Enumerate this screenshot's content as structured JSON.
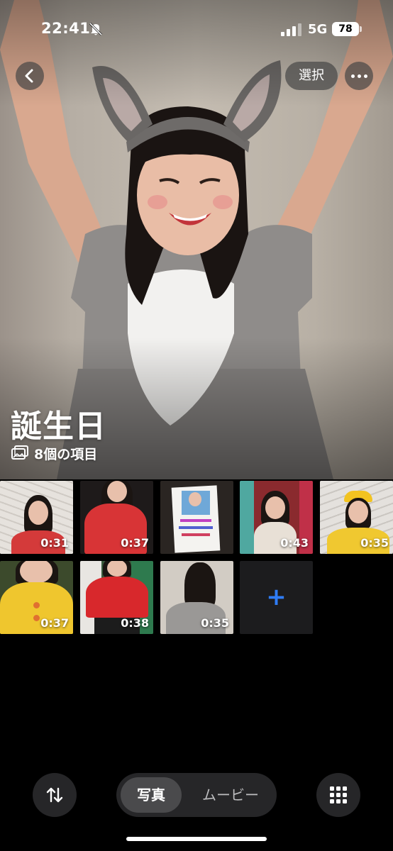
{
  "status_bar": {
    "time": "22:41",
    "network": "5G",
    "battery": "78"
  },
  "header": {
    "select_label": "選択"
  },
  "album": {
    "title": "誕生日",
    "count_text": "8個の項目"
  },
  "grid": {
    "items": [
      {
        "duration": "0:31"
      },
      {
        "duration": "0:37"
      },
      {
        "duration": ""
      },
      {
        "duration": "0:43"
      },
      {
        "duration": "0:35"
      },
      {
        "duration": "0:37"
      },
      {
        "duration": "0:38"
      },
      {
        "duration": "0:35"
      }
    ],
    "add_label": "+"
  },
  "toolbar": {
    "tab_photos": "写真",
    "tab_movies": "ムービー"
  },
  "colors": {
    "accent": "#2f7cf6",
    "background": "#000000",
    "control": "#262628"
  },
  "icons": [
    "bell-slash-icon",
    "signal-icon",
    "chevron-left-icon",
    "ellipsis-icon",
    "photo-stack-icon",
    "plus-icon",
    "sort-arrows-icon",
    "grid-icon"
  ]
}
